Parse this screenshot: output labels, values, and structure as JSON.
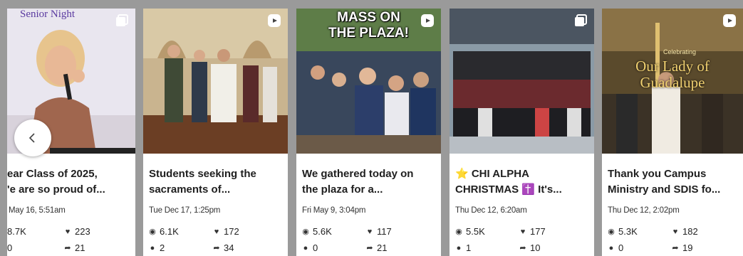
{
  "cards": [
    {
      "overlay": "Senior Night",
      "caption": "ear Class of 2025,\n'e are so proud of...",
      "date": "May 16, 5:51am",
      "views": "8.7K",
      "likes": "223",
      "comments": "0",
      "shares": "21",
      "media_icon": "carousel-icon"
    },
    {
      "overlay": "",
      "caption": "Students seeking the\nsacraments of...",
      "date": "Tue Dec 17, 1:25pm",
      "views": "6.1K",
      "likes": "172",
      "comments": "2",
      "shares": "34",
      "media_icon": "reel-icon"
    },
    {
      "overlay": "MASS ON\nTHE PLAZA!",
      "caption": "We gathered today on\nthe plaza for a...",
      "date": "Fri May 9, 3:04pm",
      "views": "5.6K",
      "likes": "117",
      "comments": "0",
      "shares": "21",
      "media_icon": "reel-icon"
    },
    {
      "overlay": "",
      "caption": "⭐ CHI ALPHA\nCHRISTMAS ✝️ It's...",
      "date": "Thu Dec 12, 6:20am",
      "views": "5.5K",
      "likes": "177",
      "comments": "1",
      "shares": "10",
      "media_icon": "carousel-icon"
    },
    {
      "overlay_small": "Celebrating",
      "overlay": "Our Lady of\nGuadalupe",
      "caption": "Thank you Campus\nMinistry and SDIS fo...",
      "date": "Thu Dec 12, 2:02pm",
      "views": "5.3K",
      "likes": "182",
      "comments": "0",
      "shares": "19",
      "media_icon": "reel-icon"
    }
  ],
  "icons": {
    "views": "eye-icon",
    "likes": "heart-icon",
    "comments": "comment-dot-icon",
    "shares": "share-arrow-icon",
    "prev": "chevron-left-icon"
  }
}
